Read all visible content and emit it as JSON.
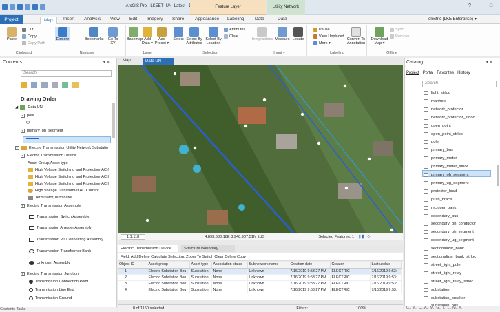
{
  "window": {
    "title": "ArcGIS Pro - LKEET_UN_Latest - Data UN",
    "ctx1": "Feature Layer",
    "ctx2": "Utility Network",
    "help": "?",
    "min": "—",
    "max": "□",
    "close": "✕"
  },
  "tabs": [
    "Project",
    "Map",
    "Insert",
    "Analysis",
    "View",
    "Edit",
    "Imagery",
    "Share",
    "Appearance",
    "Labeling",
    "Data",
    "Data"
  ],
  "user": "electric (LKE Enterprise) ▾",
  "ribbon": {
    "clipboard": {
      "label": "Clipboard",
      "paste": "Paste",
      "cut": "Cut",
      "copy": "Copy",
      "copy_path": "Copy Path"
    },
    "navigate": {
      "label": "Navigate",
      "explore": "Explore",
      "bookmarks": "Bookmarks",
      "goto": "Go To XY"
    },
    "layer": {
      "label": "Layer",
      "basemap": "Basemap",
      "add_data": "Add Data ▾",
      "add_preset": "Add Preset ▾"
    },
    "selection": {
      "label": "Selection",
      "select": "Select",
      "by_attr": "Select By Attributes",
      "by_loc": "Select By Location",
      "attributes": "Attributes",
      "clear": "Clear"
    },
    "inquiry": {
      "label": "Inquiry",
      "infographics": "Infographics",
      "measure": "Measure",
      "locate": "Locate"
    },
    "labeling": {
      "label": "Labeling",
      "pause": "Pause",
      "view_unplaced": "View Unplaced",
      "more": "More ▾",
      "convert": "Convert To Annotation"
    },
    "offline": {
      "label": "Offline",
      "download": "Download Map ▾",
      "sync": "Sync",
      "remove": "Remove"
    }
  },
  "contents": {
    "title": "Contents",
    "pin": "▾ ✕",
    "search_placeholder": "Search",
    "drawing_order": "Drawing Order",
    "items": [
      "Data UN",
      "pole",
      "primary_oh_segment",
      "Electric Transmission Utility Network Substatio",
      "Electric Transmission Device",
      "Asset Group,Asset type",
      "High Voltage Switching and Protective,AC (",
      "High Voltage Switching and Protective,AC I",
      "High Voltage Switching and Protective,AC I",
      "High Voltage Transformer,AC Current",
      "Terminator,Terminator",
      "Electric Transmission Assembly",
      "Transmission Switch Assembly",
      "Transmission Arrester Assembly",
      "Transmission PT Connecting Assembly",
      "Transmission Transformer Bank",
      "Unknown Assembly",
      "Electric Transmission Junction",
      "Transmission Connection Point",
      "Transmission Line End",
      "Transmission Ground"
    ],
    "bottom_tabs": "Contents  Tasks"
  },
  "map": {
    "tab_map": "Map",
    "tab_data": "Data UN",
    "scale": "1:1,118",
    "coords": "4,893,680.18E 3,948,907.51N ftUS",
    "selected": "Selected Features: 1"
  },
  "table": {
    "tab1": "Electric Transmission Device",
    "tab2": "Structure Boundary",
    "toolbar": "Field:  Add  Delete  Calculate   Selection:  Zoom To  Switch  Clear  Delete  Copy",
    "columns": [
      "Object ID",
      "Asset group",
      "Asset type",
      "Association status",
      "Subnetwork name",
      "Creation date",
      "Creator",
      "Last update"
    ],
    "rows": [
      [
        "1",
        "Electric Substation Bou",
        "Substation",
        "None",
        "Unknown",
        "7/16/2019 9:53:27 PM",
        "ELECTRIC",
        "7/16/2019 9:53:"
      ],
      [
        "2",
        "Electric Substation Bou",
        "Substation",
        "None",
        "Unknown",
        "7/16/2019 9:53:27 PM",
        "ELECTRIC",
        "7/16/2019 9:53:"
      ],
      [
        "3",
        "Electric Substation Bou",
        "Substation",
        "None",
        "Unknown",
        "7/16/2019 9:53:27 PM",
        "ELECTRIC",
        "7/16/2019 9:53:"
      ],
      [
        "4",
        "Electric Substation Bou",
        "Substation",
        "None",
        "Unknown",
        "7/16/2019 9:53:27 PM",
        "ELECTRIC",
        "7/16/2019 9:53:"
      ]
    ],
    "status": "0 of 1150 selected",
    "filters": "Filters:",
    "zoom": "100%"
  },
  "catalog": {
    "title": "Catalog",
    "pin": "▾ ✕",
    "tabs": [
      "Project",
      "Portal",
      "Favorites",
      "History"
    ],
    "search_placeholder": "Search",
    "items": [
      "light_strloc",
      "manhole",
      "network_protector",
      "network_protector_strloc",
      "open_point",
      "open_point_strloc",
      "pole",
      "primary_bus",
      "primary_meter",
      "primary_meter_strloc",
      "primary_oh_segment",
      "primary_ug_segment",
      "protector_load",
      "push_brace",
      "recloser_bank",
      "secondary_bus",
      "secondary_oh_conductor",
      "secondary_oh_segment",
      "secondary_ug_segment",
      "sectionalizer_bank",
      "sectionalizer_bank_strloc",
      "street_light_pole",
      "street_light_relay",
      "street_light_relay_strloc",
      "substation",
      "substation_breaker",
      "substation_bus"
    ],
    "bottom": "C..  M..  C..  A..  M..  G..  T..  L..  M..  K.."
  },
  "colors": {
    "accent": "#2c6fb7",
    "selection": "#cde3f7",
    "map_line": "#2a5fd0"
  }
}
